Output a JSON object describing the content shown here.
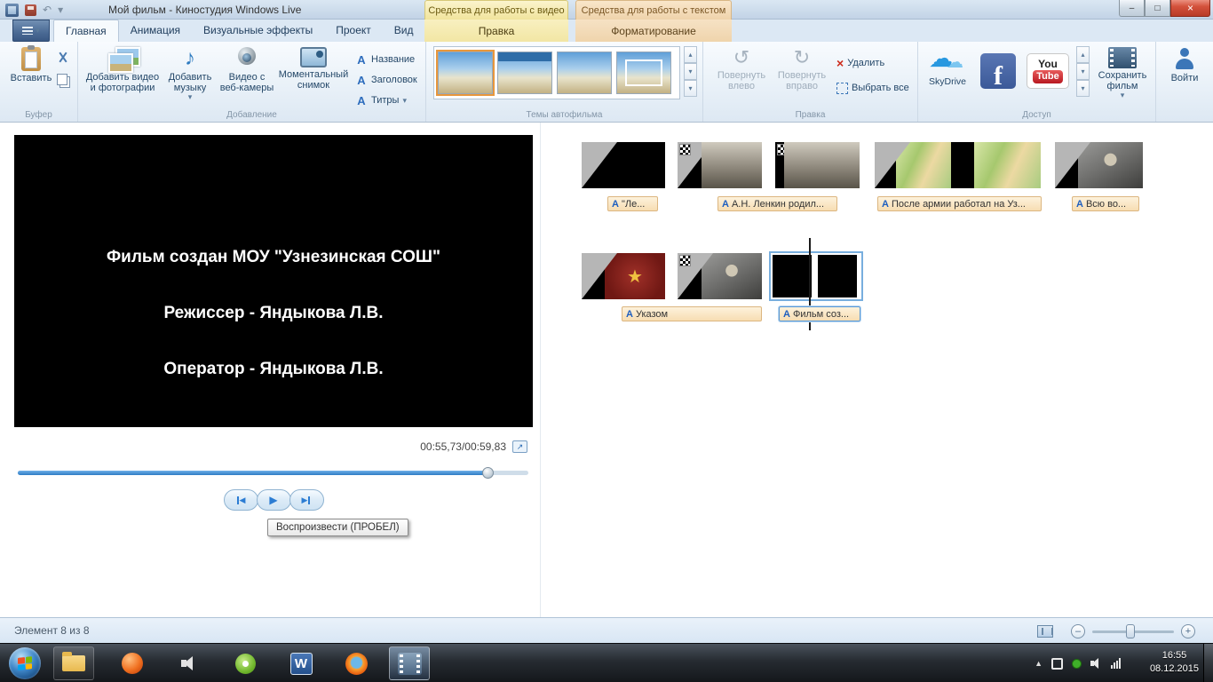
{
  "titlebar": {
    "title": "Мой фильм - Киностудия Windows Live",
    "contextual_video": "Средства для работы с видео",
    "contextual_text": "Средства для работы с текстом"
  },
  "tabs": {
    "home": "Главная",
    "animation": "Анимация",
    "visual_effects": "Визуальные эффекты",
    "project": "Проект",
    "view": "Вид",
    "edit": "Правка",
    "format": "Форматирование"
  },
  "ribbon": {
    "buffer": {
      "label": "Буфер",
      "paste": "Вставить"
    },
    "add": {
      "label": "Добавление",
      "add_video": "Добавить видео и фотографии",
      "add_music": "Добавить музыку",
      "webcam": "Видео с веб-камеры",
      "snapshot": "Моментальный снимок",
      "title": "Название",
      "caption": "Заголовок",
      "credits": "Титры"
    },
    "themes": {
      "label": "Темы автофильма"
    },
    "edit": {
      "label": "Правка",
      "rotate_left": "Повернуть влево",
      "rotate_right": "Повернуть вправо",
      "delete": "Удалить",
      "select_all": "Выбрать все"
    },
    "share": {
      "label": "Доступ",
      "skydrive": "SkyDrive",
      "save_movie": "Сохранить фильм"
    },
    "sign_in": "Войти"
  },
  "preview": {
    "title_line1": "Фильм создан МОУ \"Узнезинская СОШ\"",
    "title_line2": "Режиссер - Яндыкова Л.В.",
    "title_line3": "Оператор - Яндыкова Л.В.",
    "time": "00:55,73/00:59,83",
    "tooltip": "Воспроизвести (ПРОБЕЛ)"
  },
  "storyboard": {
    "captions": [
      "\"Ле...",
      "А.Н. Ленкин родил...",
      "После армии работал на Уз...",
      "Всю во...",
      "Указом",
      "Фильм соз..."
    ]
  },
  "statusbar": {
    "item_count": "Элемент 8 из 8"
  },
  "taskbar": {
    "time": "16:55",
    "date": "08.12.2015"
  },
  "glyphs": {
    "dropdown": "▾",
    "up": "▴",
    "undo": "↶",
    "music_note": "♪",
    "delete_x": "×",
    "rotate_left": "↺",
    "rotate_right": "↻",
    "cloud": "☁",
    "facebook_f": "f",
    "youtube_you": "You",
    "youtube_tube": "Tube",
    "overlay_a": "А",
    "play": "▶",
    "prev": "◀",
    "next": "▶",
    "expand": "↗",
    "minimize": "–",
    "maximize": "□",
    "close": "×",
    "word_w": "W",
    "star": "★",
    "tray_up": "▲",
    "minus": "–",
    "plus": "+"
  },
  "colors": {
    "accent_blue": "#2b7cd3",
    "selection_blue": "#78aede",
    "contextual_yellow": "#f7ecb0",
    "contextual_peach": "#f6ddbd",
    "caption_bg": "#fbe7c4",
    "close_red": "#d4523c"
  }
}
